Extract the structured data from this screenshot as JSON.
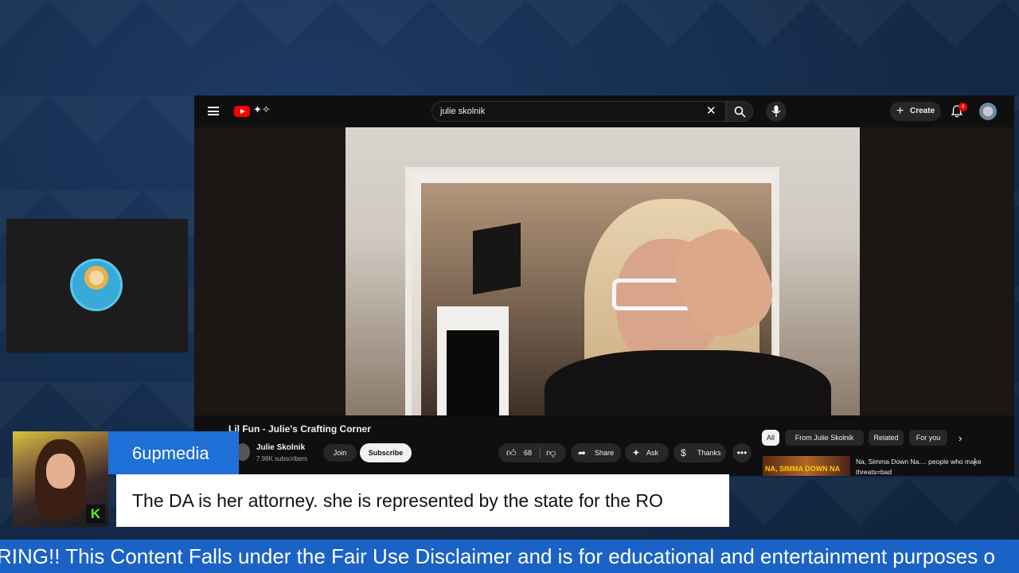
{
  "youtube": {
    "search": {
      "query": "julie skolnik"
    },
    "create_label": "Create",
    "notification_count": "4",
    "video": {
      "title": "Lil Fun - Julie's Crafting Corner",
      "channel_name": "Julie Skolnik",
      "subscribers": "7.98K subscribers",
      "join_label": "Join",
      "subscribe_label": "Subscribe",
      "like_count": "68",
      "share_label": "Share",
      "ask_label": "Ask",
      "thanks_label": "Thanks"
    },
    "chips": [
      "All",
      "From Julie Skolnik",
      "Related",
      "For you"
    ],
    "recommendation": {
      "thumbnail_text": "NA, SIMMA DOWN NA",
      "title": "Na, Simma Down Na.... people who make threats=bad"
    }
  },
  "overlay": {
    "host_name": "6upmedia",
    "message": "The DA is her attorney. she is represented by the state for the RO",
    "ticker": "RING!! This Content Falls under the Fair Use Disclaimer and is for educational and entertainment purposes o"
  },
  "colors": {
    "background": "#142a48",
    "name_bar": "#1e6fd6",
    "ticker": "#1a62c6",
    "youtube_red": "#ff0000"
  }
}
